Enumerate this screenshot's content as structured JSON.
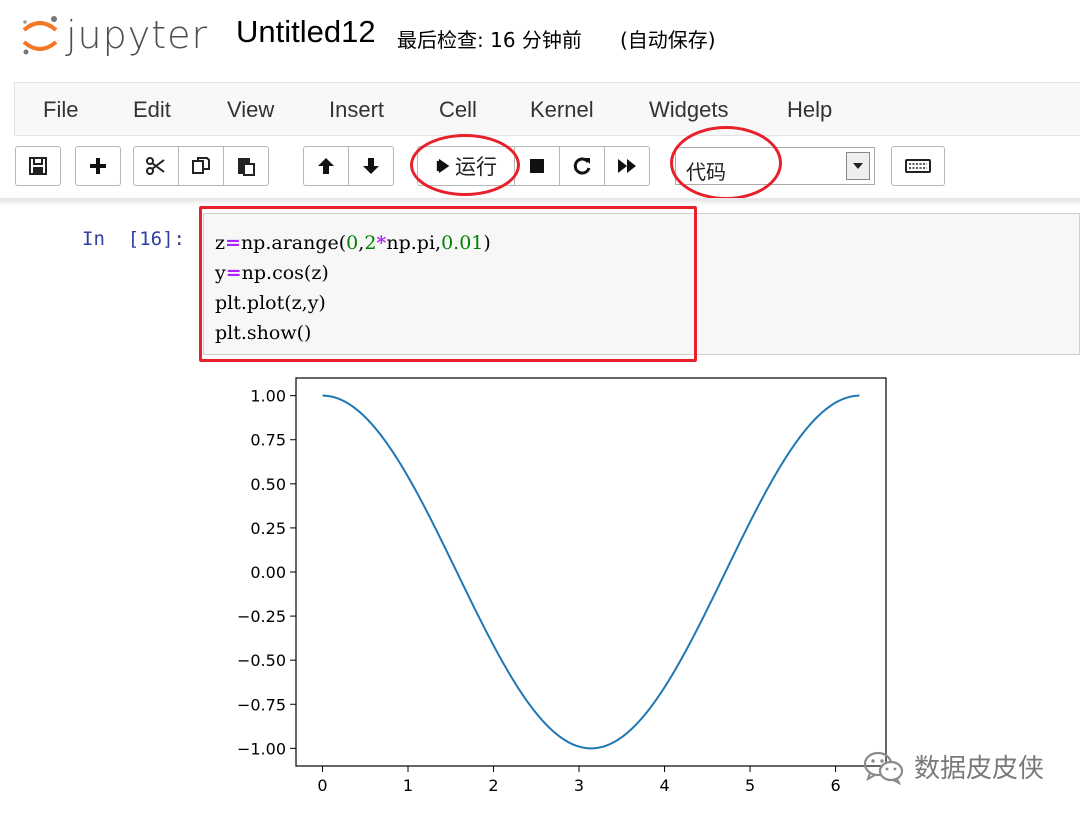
{
  "header": {
    "logo_text": "jupyter",
    "notebook_name": "Untitled12",
    "checkpoint": "最后检查: 16 分钟前",
    "autosave": "(自动保存)"
  },
  "menubar": {
    "items": [
      "File",
      "Edit",
      "View",
      "Insert",
      "Cell",
      "Kernel",
      "Widgets",
      "Help"
    ]
  },
  "toolbar": {
    "run_label": "运行",
    "cell_type": "代码",
    "icons": [
      "save-icon",
      "plus-icon",
      "cut-icon",
      "copy-icon",
      "paste-icon",
      "arrow-up-icon",
      "arrow-down-icon",
      "step-forward-icon",
      "stop-icon",
      "restart-icon",
      "fast-forward-icon",
      "keyboard-icon"
    ]
  },
  "cell": {
    "prompt": "In  [16]:",
    "code_lines": [
      "z=np.arange(0,2*np.pi,0.01)",
      "y=np.cos(z)",
      "plt.plot(z,y)",
      "plt.show()"
    ]
  },
  "colors": {
    "annotation": "#e8202a",
    "line": "#1f77b4",
    "prompt": "#303f9f"
  },
  "chart_data": {
    "type": "line",
    "function": "cos",
    "x_start": 0,
    "x_end": 6.28,
    "x_step": 0.01,
    "series": [
      {
        "values_description": "y = cos(x)"
      }
    ],
    "xlim": [
      -0.31,
      6.59
    ],
    "ylim": [
      -1.1,
      1.1
    ],
    "xticks": [
      0,
      1,
      2,
      3,
      4,
      5,
      6
    ],
    "yticks": [
      1.0,
      0.75,
      0.5,
      0.25,
      0.0,
      -0.25,
      -0.5,
      -0.75,
      -1.0
    ],
    "xtick_labels": [
      "0",
      "1",
      "2",
      "3",
      "4",
      "5",
      "6"
    ],
    "ytick_labels": [
      "1.00",
      "0.75",
      "0.50",
      "0.25",
      "0.00",
      "−0.25",
      "−0.50",
      "−0.75",
      "−1.00"
    ],
    "grid": false,
    "title": "",
    "xlabel": "",
    "ylabel": ""
  },
  "watermark": {
    "text": "数据皮皮侠"
  }
}
